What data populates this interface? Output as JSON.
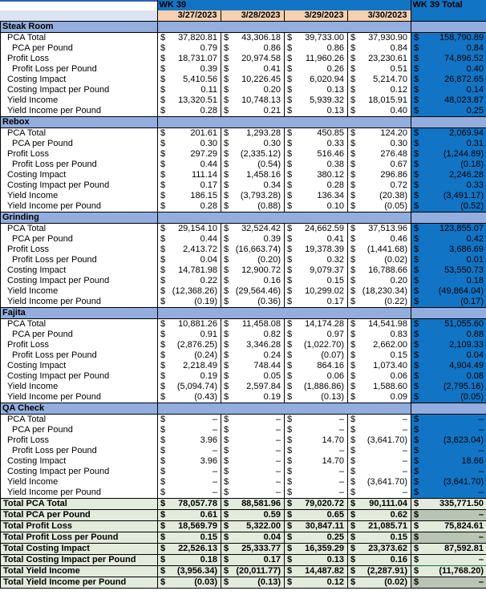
{
  "header": {
    "week_label": "WK 39",
    "total_label": "WK 39 Total",
    "dates": [
      "3/27/2023",
      "3/28/2023",
      "3/29/2023",
      "3/30/2023"
    ]
  },
  "colors": {
    "header_blue": "#1274c4",
    "date_peach": "#f7d0b0",
    "section_blue": "#93aede",
    "total_green": "#e2ebdc",
    "total_grey": "#b9c4b4",
    "selection_green": "#1a6b45",
    "selection_blue": "#2b5fb8"
  },
  "metric_labels": [
    "PCA Total",
    "PCA per Pound",
    "Profit Loss",
    "Profit Loss per Pound",
    "Costing Impact",
    "Costing Impact per Pound",
    "Yield Income",
    "Yield Income per Pound"
  ],
  "currency_symbol": "$",
  "sections": [
    {
      "name": "Steak Room",
      "rows": [
        {
          "label": "PCA Total",
          "indent": 1,
          "values": [
            "37,820.81",
            "43,306.18",
            "39,733.00",
            "37,930.90"
          ],
          "total": "158,790.89"
        },
        {
          "label": "PCA per Pound",
          "indent": 2,
          "values": [
            "0.79",
            "0.86",
            "0.86",
            "0.84"
          ],
          "total": "0.84"
        },
        {
          "label": "Profit Loss",
          "indent": 1,
          "values": [
            "18,731.07",
            "20,974.58",
            "11,960.26",
            "23,230.61"
          ],
          "total": "74,896.52"
        },
        {
          "label": "Profit Loss per Pound",
          "indent": 2,
          "values": [
            "0.39",
            "0.41",
            "0.26",
            "0.51"
          ],
          "total": "0.40"
        },
        {
          "label": "Costing Impact",
          "indent": 1,
          "values": [
            "5,410.56",
            "10,226.45",
            "6,020.94",
            "5,214.70"
          ],
          "total": "26,872.65"
        },
        {
          "label": "Costing Impact per Pound",
          "indent": 1,
          "values": [
            "0.11",
            "0.20",
            "0.13",
            "0.12"
          ],
          "total": "0.14"
        },
        {
          "label": "Yield Income",
          "indent": 1,
          "values": [
            "13,320.51",
            "10,748.13",
            "5,939.32",
            "18,015.91"
          ],
          "total": "48,023.87"
        },
        {
          "label": "Yield Income per Pound",
          "indent": 1,
          "values": [
            "0.28",
            "0.21",
            "0.13",
            "0.40"
          ],
          "total": "0.25"
        }
      ]
    },
    {
      "name": "Rebox",
      "rows": [
        {
          "label": "PCA Total",
          "indent": 1,
          "values": [
            "201.61",
            "1,293.28",
            "450.85",
            "124.20"
          ],
          "total": "2,069.94"
        },
        {
          "label": "PCA per Pound",
          "indent": 2,
          "values": [
            "0.30",
            "0.30",
            "0.33",
            "0.30"
          ],
          "total": "0.31"
        },
        {
          "label": "Profit Loss",
          "indent": 1,
          "values": [
            "297.29",
            "(2,335.12)",
            "516.46",
            "276.48"
          ],
          "total": "(1,244.89)"
        },
        {
          "label": "Profit Loss per Pound",
          "indent": 2,
          "values": [
            "0.44",
            "(0.54)",
            "0.38",
            "0.67"
          ],
          "total": "(0.18)"
        },
        {
          "label": "Costing Impact",
          "indent": 1,
          "values": [
            "111.14",
            "1,458.16",
            "380.12",
            "296.86"
          ],
          "total": "2,246.28"
        },
        {
          "label": "Costing Impact per Pound",
          "indent": 1,
          "values": [
            "0.17",
            "0.34",
            "0.28",
            "0.72"
          ],
          "total": "0.33"
        },
        {
          "label": "Yield Income",
          "indent": 1,
          "values": [
            "186.15",
            "(3,793.28)",
            "136.34",
            "(20.38)"
          ],
          "total": "(3,491.17)"
        },
        {
          "label": "Yield Income per Pound",
          "indent": 1,
          "values": [
            "0.28",
            "(0.88)",
            "0.10",
            "(0.05)"
          ],
          "total": "(0.52)"
        }
      ]
    },
    {
      "name": "Grinding",
      "rows": [
        {
          "label": "PCA Total",
          "indent": 1,
          "values": [
            "29,154.10",
            "32,524.42",
            "24,662.59",
            "37,513.96"
          ],
          "total": "123,855.07"
        },
        {
          "label": "PCA per Pound",
          "indent": 2,
          "values": [
            "0.44",
            "0.39",
            "0.41",
            "0.46"
          ],
          "total": "0.42"
        },
        {
          "label": "Profit Loss",
          "indent": 1,
          "values": [
            "2,413.72",
            "(16,663.74)",
            "19,378.39",
            "(1,441.68)"
          ],
          "total": "3,686.69"
        },
        {
          "label": "Profit Loss per Pound",
          "indent": 2,
          "values": [
            "0.04",
            "(0.20)",
            "0.32",
            "(0.02)"
          ],
          "total": "0.01"
        },
        {
          "label": "Costing Impact",
          "indent": 1,
          "values": [
            "14,781.98",
            "12,900.72",
            "9,079.37",
            "16,788.66"
          ],
          "total": "53,550.73"
        },
        {
          "label": "Costing Impact per Pound",
          "indent": 1,
          "values": [
            "0.22",
            "0.16",
            "0.15",
            "0.20"
          ],
          "total": "0.18"
        },
        {
          "label": "Yield Income",
          "indent": 1,
          "values": [
            "(12,368.26)",
            "(29,564.46)",
            "10,299.02",
            "(18,230.34)"
          ],
          "total": "(49,864.04)"
        },
        {
          "label": "Yield Income per Pound",
          "indent": 1,
          "values": [
            "(0.19)",
            "(0.36)",
            "0.17",
            "(0.22)"
          ],
          "total": "(0.17)"
        }
      ]
    },
    {
      "name": "Fajita",
      "rows": [
        {
          "label": "PCA Total",
          "indent": 1,
          "values": [
            "10,881.26",
            "11,458.08",
            "14,174.28",
            "14,541.98"
          ],
          "total": "51,055.60"
        },
        {
          "label": "PCA per Pound",
          "indent": 2,
          "values": [
            "0.91",
            "0.82",
            "0.97",
            "0.83"
          ],
          "total": "0.88"
        },
        {
          "label": "Profit Loss",
          "indent": 1,
          "values": [
            "(2,876.25)",
            "3,346.28",
            "(1,022.70)",
            "2,662.00"
          ],
          "total": "2,109.33"
        },
        {
          "label": "Profit Loss per Pound",
          "indent": 2,
          "values": [
            "(0.24)",
            "0.24",
            "(0.07)",
            "0.15"
          ],
          "total": "0.04"
        },
        {
          "label": "Costing Impact",
          "indent": 1,
          "values": [
            "2,218.49",
            "748.44",
            "864.16",
            "1,073.40"
          ],
          "total": "4,904.49"
        },
        {
          "label": "Costing Impact per Pound",
          "indent": 1,
          "values": [
            "0.19",
            "0.05",
            "0.06",
            "0.06"
          ],
          "total": "0.08"
        },
        {
          "label": "Yield Income",
          "indent": 1,
          "values": [
            "(5,094.74)",
            "2,597.84",
            "(1,886.86)",
            "1,588.60"
          ],
          "total": "(2,795.16)"
        },
        {
          "label": "Yield Income per Pound",
          "indent": 1,
          "values": [
            "(0.43)",
            "0.19",
            "(0.13)",
            "0.09"
          ],
          "total": "(0.05)"
        }
      ]
    },
    {
      "name": "QA Check",
      "rows": [
        {
          "label": "PCA Total",
          "indent": 1,
          "values": [
            "–",
            "–",
            "–",
            "–"
          ],
          "total": "–"
        },
        {
          "label": "PCA per Pound",
          "indent": 2,
          "values": [
            "–",
            "–",
            "–",
            "–"
          ],
          "total": "–"
        },
        {
          "label": "Profit Loss",
          "indent": 1,
          "values": [
            "3.96",
            "–",
            "14.70",
            "(3,641.70)"
          ],
          "total": "(3,623.04)"
        },
        {
          "label": "Profit Loss per Pound",
          "indent": 2,
          "values": [
            "–",
            "–",
            "–",
            "–"
          ],
          "total": "–"
        },
        {
          "label": "Costing Impact",
          "indent": 1,
          "values": [
            "3.96",
            "–",
            "14.70",
            "–"
          ],
          "total": "18.66"
        },
        {
          "label": "Costing Impact per Pound",
          "indent": 1,
          "values": [
            "–",
            "–",
            "–",
            "–"
          ],
          "total": "–"
        },
        {
          "label": "Yield Income",
          "indent": 1,
          "values": [
            "–",
            "–",
            "–",
            "(3,641.70)"
          ],
          "total": "(3,641.70)"
        },
        {
          "label": "Yield Income per Pound",
          "indent": 1,
          "values": [
            "–",
            "–",
            "–",
            "–"
          ],
          "total": "–"
        }
      ]
    }
  ],
  "totals": [
    {
      "label": "Total PCA Total",
      "values": [
        "78,057.78",
        "88,581.96",
        "79,020.72",
        "90,111.04"
      ],
      "total": "335,771.50",
      "total_greyed": false,
      "selected": false
    },
    {
      "label": "Total  PCA per Pound",
      "values": [
        "0.61",
        "0.59",
        "0.65",
        "0.62"
      ],
      "total": "–",
      "total_greyed": true,
      "selected": false
    },
    {
      "label": "Total Profit Loss",
      "values": [
        "18,569.79",
        "5,322.00",
        "30,847.11",
        "21,085.71"
      ],
      "total": "75,824.61",
      "total_greyed": false,
      "selected": false
    },
    {
      "label": "Total   Profit Loss per Pound",
      "values": [
        "0.15",
        "0.04",
        "0.25",
        "0.15"
      ],
      "total": "–",
      "total_greyed": true,
      "selected": false
    },
    {
      "label": "Total  Costing Impact",
      "values": [
        "22,526.13",
        "25,333.77",
        "16,359.29",
        "23,373.62"
      ],
      "total": "87,592.81",
      "total_greyed": false,
      "selected": false
    },
    {
      "label": "Total  Costing Impact per Pound",
      "values": [
        "0.18",
        "0.17",
        "0.13",
        "0.16"
      ],
      "total": "–",
      "total_greyed": false,
      "selected": true
    },
    {
      "label": "Total   Yield Income",
      "values": [
        "(3,956.34)",
        "(20,011.77)",
        "14,487.82",
        "(2,287.91)"
      ],
      "total": "(11,768.20)",
      "total_greyed": false,
      "selected": false
    },
    {
      "label": "Total   Yield Income per Pound",
      "values": [
        "(0.03)",
        "(0.13)",
        "0.12",
        "(0.02)"
      ],
      "total": "–",
      "total_greyed": true,
      "selected": false
    }
  ]
}
